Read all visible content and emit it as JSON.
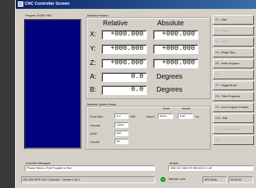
{
  "window": {
    "title": "CNC Controller Screen"
  },
  "program": {
    "label": "Program: NONE.PNC"
  },
  "machine_position": {
    "group_label": "Machine Position",
    "relative_header": "Relative",
    "absolute_header": "Absolute",
    "axes": [
      {
        "label": "X:",
        "relative": "+000.000",
        "absolute": "+000.000"
      },
      {
        "label": "Y:",
        "relative": "+000.000",
        "absolute": "+000.000"
      },
      {
        "label": "Z:",
        "relative": "+000.000",
        "absolute": "+000.000"
      },
      {
        "label": "A:",
        "relative": "0.0",
        "unit": "Degrees"
      },
      {
        "label": "B:",
        "relative": "0.0",
        "unit": "Degrees"
      }
    ]
  },
  "status": {
    "group_label": "Machine System Status",
    "feed_rate_label": "Feed Rate",
    "feed_rate_value": "0.0",
    "feed_rate_unit": "IPM",
    "head_label": "Head 1",
    "jewel_label": "Jewel",
    "jewel_value": "50/12",
    "nozzle_label": "Nozzle",
    "nozzle_value": "9.60",
    "nozzle_unit": "Hz",
    "override_label": "Override",
    "override_value": "100%",
    "kerf_label": "KERF",
    "kerf_value": "800",
    "counter_label": "Counter",
    "counter_value": "65"
  },
  "function_keys": [
    {
      "label": "F1 - Start",
      "enabled": true
    },
    {
      "label": "F2 - Pause",
      "enabled": false
    },
    {
      "label": "F3 - Abort",
      "enabled": false
    },
    {
      "label": "F4 - Single Step",
      "enabled": true
    },
    {
      "label": "F5 - Verify Program",
      "enabled": true
    },
    {
      "label": "F6",
      "enabled": false
    },
    {
      "label": "F7 - Toggle Mode",
      "enabled": true
    },
    {
      "label": "F8 - Parts Programs",
      "enabled": true
    },
    {
      "label": "F9 - Zero Program Position",
      "enabled": true
    },
    {
      "label": "F10 - Edit",
      "enabled": true
    },
    {
      "label": "F11 - Cycle Counter",
      "enabled": false
    },
    {
      "label": "F12",
      "enabled": false
    }
  ],
  "messages": {
    "controller_label": "Controller Messages",
    "controller_text": "Please Select a Part Program to Run",
    "models_label": "Models",
    "models_text": "GBD 617 646 679 GBI 640 CC off"
  },
  "statusbar": {
    "version": "RE 2000 M7® CNC Controller · Version 4.90.1",
    "mode": "Manual Local",
    "mdi": "MDI Mode",
    "time": "00:00:16"
  },
  "colors": {
    "title_start": "#0a246a",
    "program_bg": "#00007c",
    "led": "#1ec81e"
  }
}
